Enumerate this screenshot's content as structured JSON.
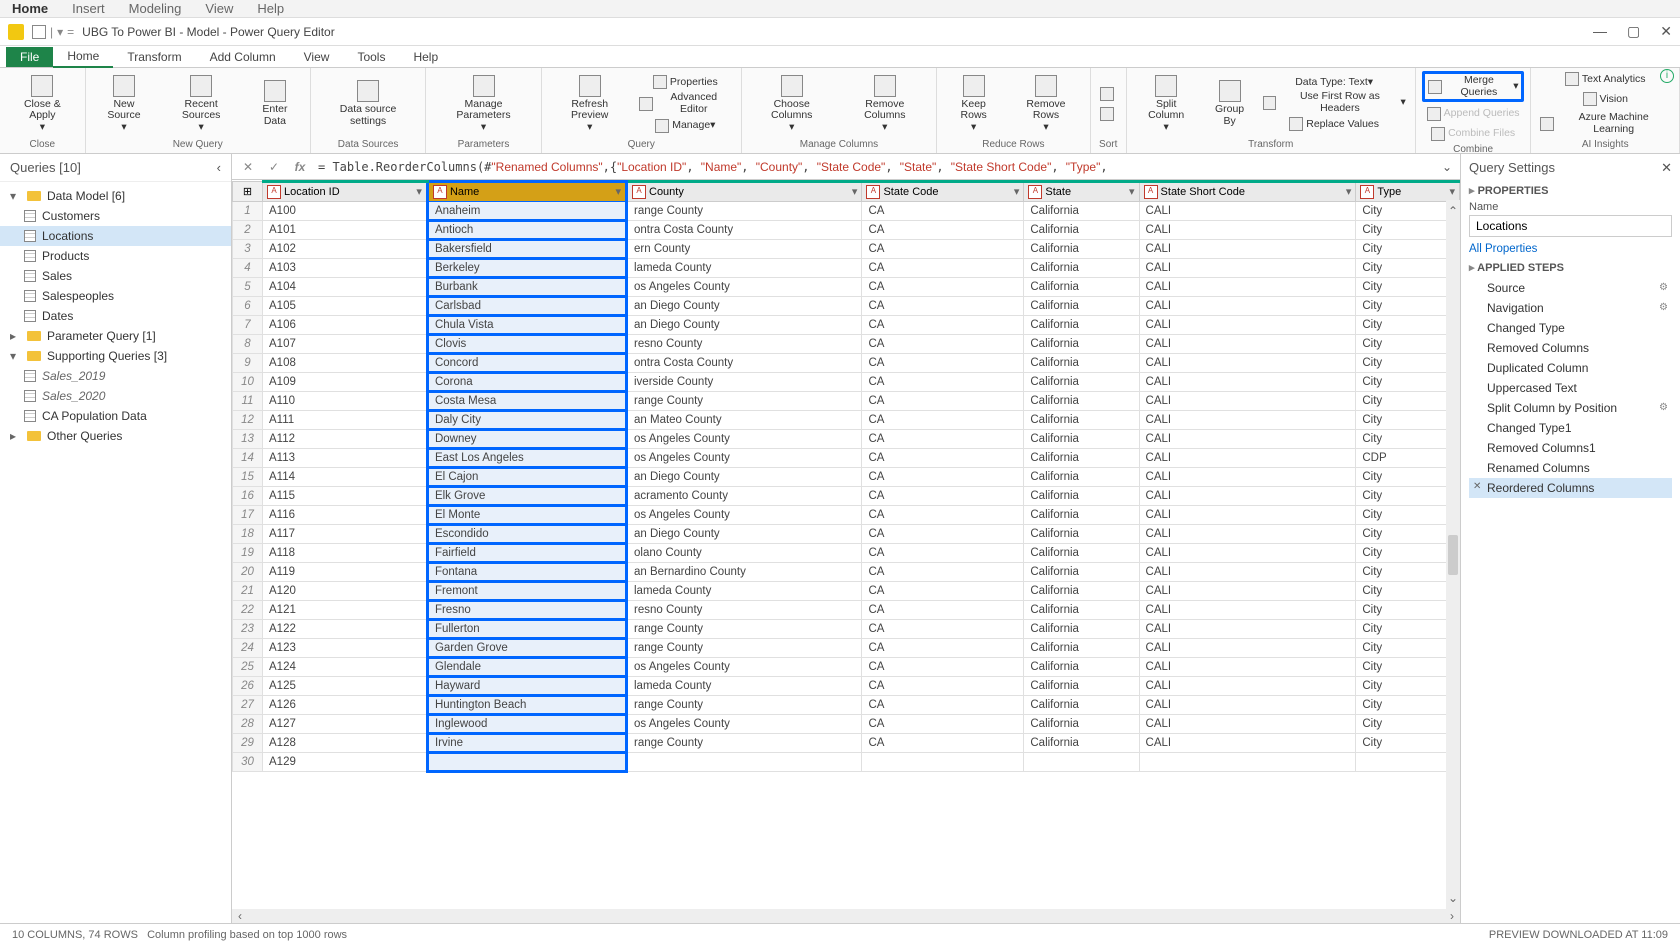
{
  "outer_menu": [
    "Home",
    "Insert",
    "Modeling",
    "View",
    "Help"
  ],
  "titlebar": {
    "title": "UBG To Power BI - Model - Power Query Editor"
  },
  "ribbon_tabs": {
    "file": "File",
    "items": [
      "Home",
      "Transform",
      "Add Column",
      "View",
      "Tools",
      "Help"
    ],
    "active": "Home"
  },
  "ribbon": {
    "close": {
      "btn": "Close &\nApply",
      "label": "Close"
    },
    "newquery": {
      "btns": [
        "New\nSource",
        "Recent\nSources",
        "Enter\nData"
      ],
      "label": "New Query"
    },
    "datasources": {
      "btn": "Data source\nsettings",
      "label": "Data Sources"
    },
    "parameters": {
      "btn": "Manage\nParameters",
      "label": "Parameters"
    },
    "query": {
      "refresh": "Refresh\nPreview",
      "props": "Properties",
      "adv": "Advanced Editor",
      "manage": "Manage",
      "label": "Query"
    },
    "managecols": {
      "btns": [
        "Choose\nColumns",
        "Remove\nColumns"
      ],
      "label": "Manage Columns"
    },
    "reducerows": {
      "btns": [
        "Keep\nRows",
        "Remove\nRows"
      ],
      "label": "Reduce Rows"
    },
    "sort": {
      "label": "Sort"
    },
    "transform": {
      "split": "Split\nColumn",
      "group": "Group\nBy",
      "datatype": "Data Type: Text",
      "firstrow": "Use First Row as Headers",
      "replace": "Replace Values",
      "label": "Transform"
    },
    "combine": {
      "merge": "Merge Queries",
      "append": "Append Queries",
      "combine": "Combine Files",
      "label": "Combine"
    },
    "ai": {
      "text": "Text Analytics",
      "vision": "Vision",
      "ml": "Azure Machine Learning",
      "label": "AI Insights"
    }
  },
  "queries": {
    "header": "Queries [10]",
    "datamodel": {
      "label": "Data Model [6]",
      "items": [
        "Customers",
        "Locations",
        "Products",
        "Sales",
        "Salespeoples",
        "Dates"
      ],
      "selected": "Locations"
    },
    "paramquery": {
      "label": "Parameter Query [1]"
    },
    "supporting": {
      "label": "Supporting Queries [3]",
      "items": [
        "Sales_2019",
        "Sales_2020",
        "CA Population Data"
      ]
    },
    "other": {
      "label": "Other Queries"
    }
  },
  "formula": {
    "prefix": "= Table.ReorderColumns(#",
    "renamed": "\"Renamed Columns\"",
    "mid": ",{",
    "cols": [
      "\"Location ID\"",
      "\"Name\"",
      "\"County\"",
      "\"State Code\"",
      "\"State\"",
      "\"State Short Code\"",
      "\"Type\""
    ],
    "suffix": ","
  },
  "grid": {
    "headers": [
      "Location ID",
      "Name",
      "County",
      "State Code",
      "State",
      "State Short Code",
      "Type"
    ],
    "rows": [
      [
        "A100",
        "Anaheim",
        "range County",
        "CA",
        "California",
        "CALI",
        "City"
      ],
      [
        "A101",
        "Antioch",
        "ontra Costa County",
        "CA",
        "California",
        "CALI",
        "City"
      ],
      [
        "A102",
        "Bakersfield",
        "ern County",
        "CA",
        "California",
        "CALI",
        "City"
      ],
      [
        "A103",
        "Berkeley",
        "lameda County",
        "CA",
        "California",
        "CALI",
        "City"
      ],
      [
        "A104",
        "Burbank",
        "os Angeles County",
        "CA",
        "California",
        "CALI",
        "City"
      ],
      [
        "A105",
        "Carlsbad",
        "an Diego County",
        "CA",
        "California",
        "CALI",
        "City"
      ],
      [
        "A106",
        "Chula Vista",
        "an Diego County",
        "CA",
        "California",
        "CALI",
        "City"
      ],
      [
        "A107",
        "Clovis",
        "resno County",
        "CA",
        "California",
        "CALI",
        "City"
      ],
      [
        "A108",
        "Concord",
        "ontra Costa County",
        "CA",
        "California",
        "CALI",
        "City"
      ],
      [
        "A109",
        "Corona",
        "iverside County",
        "CA",
        "California",
        "CALI",
        "City"
      ],
      [
        "A110",
        "Costa Mesa",
        "range County",
        "CA",
        "California",
        "CALI",
        "City"
      ],
      [
        "A111",
        "Daly City",
        "an Mateo County",
        "CA",
        "California",
        "CALI",
        "City"
      ],
      [
        "A112",
        "Downey",
        "os Angeles County",
        "CA",
        "California",
        "CALI",
        "City"
      ],
      [
        "A113",
        "East Los Angeles",
        "os Angeles County",
        "CA",
        "California",
        "CALI",
        "CDP"
      ],
      [
        "A114",
        "El Cajon",
        "an Diego County",
        "CA",
        "California",
        "CALI",
        "City"
      ],
      [
        "A115",
        "Elk Grove",
        "acramento County",
        "CA",
        "California",
        "CALI",
        "City"
      ],
      [
        "A116",
        "El Monte",
        "os Angeles County",
        "CA",
        "California",
        "CALI",
        "City"
      ],
      [
        "A117",
        "Escondido",
        "an Diego County",
        "CA",
        "California",
        "CALI",
        "City"
      ],
      [
        "A118",
        "Fairfield",
        "olano County",
        "CA",
        "California",
        "CALI",
        "City"
      ],
      [
        "A119",
        "Fontana",
        "an Bernardino County",
        "CA",
        "California",
        "CALI",
        "City"
      ],
      [
        "A120",
        "Fremont",
        "lameda County",
        "CA",
        "California",
        "CALI",
        "City"
      ],
      [
        "A121",
        "Fresno",
        "resno County",
        "CA",
        "California",
        "CALI",
        "City"
      ],
      [
        "A122",
        "Fullerton",
        "range County",
        "CA",
        "California",
        "CALI",
        "City"
      ],
      [
        "A123",
        "Garden Grove",
        "range County",
        "CA",
        "California",
        "CALI",
        "City"
      ],
      [
        "A124",
        "Glendale",
        "os Angeles County",
        "CA",
        "California",
        "CALI",
        "City"
      ],
      [
        "A125",
        "Hayward",
        "lameda County",
        "CA",
        "California",
        "CALI",
        "City"
      ],
      [
        "A126",
        "Huntington Beach",
        "range County",
        "CA",
        "California",
        "CALI",
        "City"
      ],
      [
        "A127",
        "Inglewood",
        "os Angeles County",
        "CA",
        "California",
        "CALI",
        "City"
      ],
      [
        "A128",
        "Irvine",
        "range County",
        "CA",
        "California",
        "CALI",
        "City"
      ],
      [
        "A129",
        "",
        "",
        "",
        "",
        "",
        ""
      ]
    ]
  },
  "settings": {
    "header": "Query Settings",
    "props": "PROPERTIES",
    "name_label": "Name",
    "name_value": "Locations",
    "all_props": "All Properties",
    "applied": "APPLIED STEPS",
    "steps": [
      {
        "t": "Source",
        "g": true
      },
      {
        "t": "Navigation",
        "g": true
      },
      {
        "t": "Changed Type"
      },
      {
        "t": "Removed Columns"
      },
      {
        "t": "Duplicated Column"
      },
      {
        "t": "Uppercased Text"
      },
      {
        "t": "Split Column by Position",
        "g": true
      },
      {
        "t": "Changed Type1"
      },
      {
        "t": "Removed Columns1"
      },
      {
        "t": "Renamed Columns"
      },
      {
        "t": "Reordered Columns",
        "sel": true
      }
    ]
  },
  "statusbar": {
    "left": "10 COLUMNS, 74 ROWS",
    "mid": "Column profiling based on top 1000 rows",
    "right": "PREVIEW DOWNLOADED AT 11:09"
  }
}
